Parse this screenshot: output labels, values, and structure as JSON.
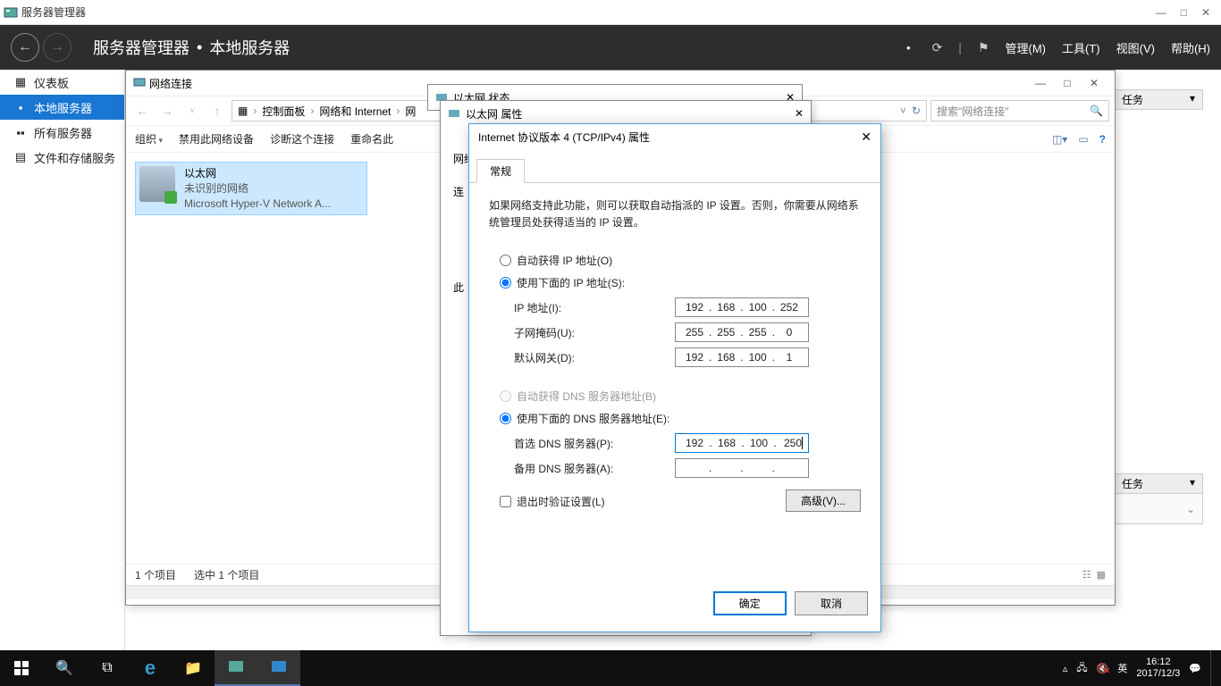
{
  "app": {
    "title": "服务器管理器"
  },
  "header": {
    "breadcrumb1": "服务器管理器",
    "breadcrumb2": "本地服务器",
    "menus": [
      "管理(M)",
      "工具(T)",
      "视图(V)",
      "帮助(H)"
    ]
  },
  "sidebar": {
    "items": [
      {
        "label": "仪表板"
      },
      {
        "label": "本地服务器"
      },
      {
        "label": "所有服务器"
      },
      {
        "label": "文件和存储服务"
      }
    ]
  },
  "tasks_label": "任务",
  "ncwin": {
    "title": "网络连接",
    "breadcrumb": [
      "控制面板",
      "网络和 Internet",
      "网"
    ],
    "search_placeholder": "搜索\"网络连接\"",
    "cmds": {
      "org": "组织",
      "disable": "禁用此网络设备",
      "diag": "诊断这个连接",
      "rename": "重命名此"
    },
    "item": {
      "name": "以太网",
      "status": "未识别的网络",
      "adapter": "Microsoft Hyper-V Network A..."
    },
    "status_left": "1 个项目",
    "status_sel": "选中 1 个项目"
  },
  "ethstatus": {
    "title": "以太网 状态"
  },
  "ethprop": {
    "title": "以太网 属性",
    "section": "网络",
    "conn": "连"
  },
  "ipv4": {
    "title": "Internet 协议版本 4 (TCP/IPv4) 属性",
    "tab": "常规",
    "desc": "如果网络支持此功能，则可以获取自动指派的 IP 设置。否则，你需要从网络系统管理员处获得适当的 IP 设置。",
    "radio_auto_ip": "自动获得 IP 地址(O)",
    "radio_use_ip": "使用下面的 IP 地址(S):",
    "lbl_ip": "IP 地址(I):",
    "lbl_mask": "子网掩码(U):",
    "lbl_gw": "默认网关(D):",
    "radio_auto_dns": "自动获得 DNS 服务器地址(B)",
    "radio_use_dns": "使用下面的 DNS 服务器地址(E):",
    "lbl_dns1": "首选 DNS 服务器(P):",
    "lbl_dns2": "备用 DNS 服务器(A):",
    "chk_validate": "退出时验证设置(L)",
    "adv": "高级(V)...",
    "ok": "确定",
    "cancel": "取消",
    "ip": [
      "192",
      "168",
      "100",
      "252"
    ],
    "mask": [
      "255",
      "255",
      "255",
      "0"
    ],
    "gw": [
      "192",
      "168",
      "100",
      "1"
    ],
    "dns1": [
      "192",
      "168",
      "100",
      "250"
    ],
    "dns2": [
      "",
      "",
      "",
      ""
    ]
  },
  "taskbar": {
    "time": "16:12",
    "date": "2017/12/3",
    "ime": "英"
  }
}
